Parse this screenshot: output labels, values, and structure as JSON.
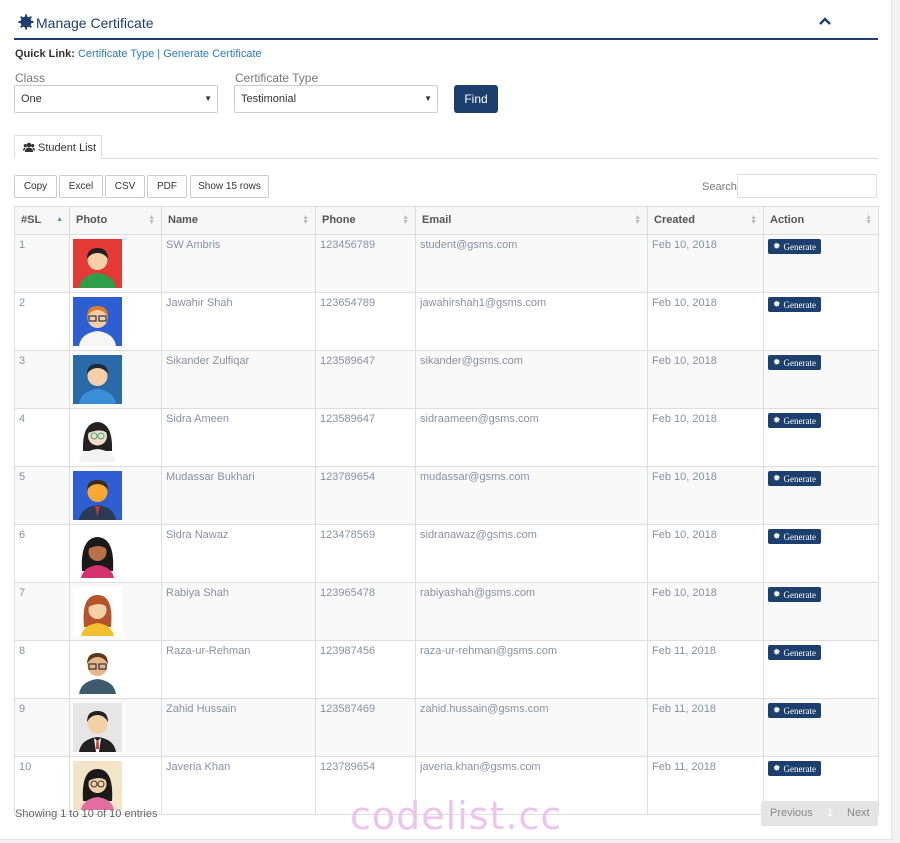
{
  "header": {
    "title": "Manage Certificate",
    "icon": "gear-icon",
    "collapse_icon": "chevron-up-icon"
  },
  "quick_links": {
    "label": "Quick Link:",
    "links": [
      "Certificate Type",
      "Generate Certificate"
    ],
    "separator": "|"
  },
  "filters": {
    "class_label": "Class",
    "class_value": "One",
    "type_label": "Certificate Type",
    "type_value": "Testimonial",
    "find_label": "Find"
  },
  "tab": {
    "label": "Student List",
    "icon": "users-icon"
  },
  "toolbar": {
    "buttons": [
      "Copy",
      "Excel",
      "CSV",
      "PDF",
      "Show 15 rows"
    ],
    "search_label": "Search:"
  },
  "table": {
    "columns": [
      "#SL",
      "Photo",
      "Name",
      "Phone",
      "Email",
      "Created",
      "Action"
    ],
    "rows": [
      {
        "sl": "1",
        "name": "SW Ambris",
        "phone": "123456789",
        "email": "student@gsms.com",
        "created": "Feb 10, 2018",
        "action": "Generate"
      },
      {
        "sl": "2",
        "name": "Jawahir Shah",
        "phone": "123654789",
        "email": "jawahirshah1@gsms.com",
        "created": "Feb 10, 2018",
        "action": "Generate"
      },
      {
        "sl": "3",
        "name": "Sikander Zulfiqar",
        "phone": "123589647",
        "email": "sikander@gsms.com",
        "created": "Feb 10, 2018",
        "action": "Generate"
      },
      {
        "sl": "4",
        "name": "Sidra Ameen",
        "phone": "123589647",
        "email": "sidraameen@gsms.com",
        "created": "Feb 10, 2018",
        "action": "Generate"
      },
      {
        "sl": "5",
        "name": "Mudassar Bukhari",
        "phone": "123789654",
        "email": "mudassar@gsms.com",
        "created": "Feb 10, 2018",
        "action": "Generate"
      },
      {
        "sl": "6",
        "name": "Sidra Nawaz",
        "phone": "123478569",
        "email": "sidranawaz@gsms.com",
        "created": "Feb 10, 2018",
        "action": "Generate"
      },
      {
        "sl": "7",
        "name": "Rabiya Shah",
        "phone": "123965478",
        "email": "rabiyashah@gsms.com",
        "created": "Feb 10, 2018",
        "action": "Generate"
      },
      {
        "sl": "8",
        "name": "Raza-ur-Rehman",
        "phone": "123987456",
        "email": "raza-ur-rehman@gsms.com",
        "created": "Feb 11, 2018",
        "action": "Generate"
      },
      {
        "sl": "9",
        "name": "Zahid Hussain",
        "phone": "123587469",
        "email": "zahid.hussain@gsms.com",
        "created": "Feb 11, 2018",
        "action": "Generate"
      },
      {
        "sl": "10",
        "name": "Javeria Khan",
        "phone": "123789654",
        "email": "javeria.khan@gsms.com",
        "created": "Feb 11, 2018",
        "action": "Generate"
      }
    ]
  },
  "footer": {
    "info": "Showing 1 to 10 of 10 entries",
    "prev": "Previous",
    "page": "1",
    "next": "Next"
  },
  "watermark": "codelist.cc",
  "colors": {
    "primary": "#1c3f6e",
    "link": "#2a7bbf"
  }
}
